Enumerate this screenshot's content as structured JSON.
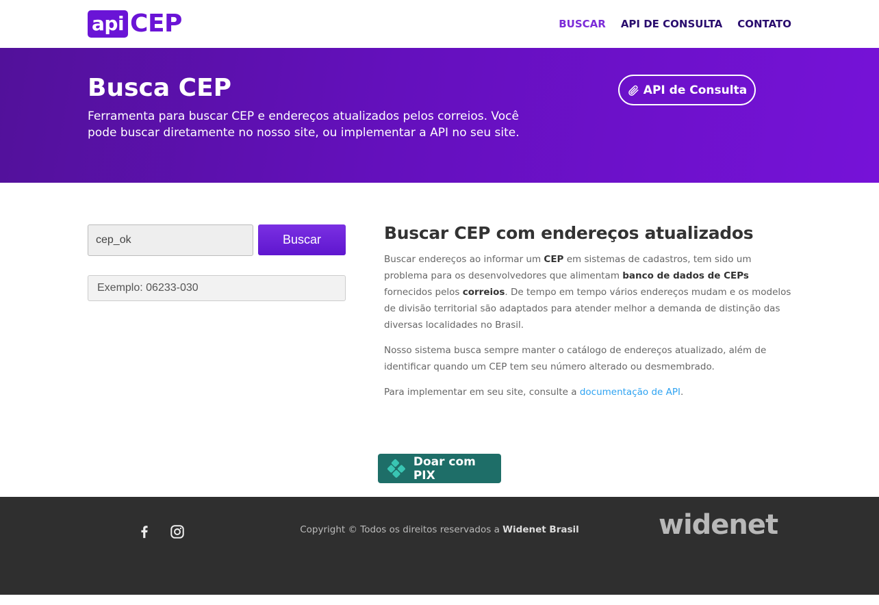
{
  "header": {
    "logo_api": "api",
    "logo_cep": "CEP",
    "nav": [
      {
        "label": "BUSCAR",
        "active": true
      },
      {
        "label": "API DE CONSULTA",
        "active": false
      },
      {
        "label": "CONTATO",
        "active": false
      }
    ]
  },
  "hero": {
    "title": "Busca CEP",
    "description": "Ferramenta para buscar CEP e endereços atualizados pelos correios. Você pode buscar diretamente no nosso site, ou implementar a API no seu site.",
    "button_label": "API de Consulta",
    "button_icon": "paperclip-icon"
  },
  "search": {
    "cep_value": "cep_ok",
    "button_label": "Buscar",
    "example_placeholder": "Exemplo: 06233-030"
  },
  "content": {
    "title": "Buscar CEP com endereços atualizados",
    "p1_a": "Buscar endereços ao informar um ",
    "p1_b1": "CEP",
    "p1_c": " em sistemas de cadastros, tem sido um problema para os desenvolvedores que alimentam ",
    "p1_b2": "banco de dados de CEPs",
    "p1_d": " fornecidos pelos ",
    "p1_b3": "correios",
    "p1_e": ". De tempo em tempo vários endereços mudam e os modelos de divisão territorial são adaptados para atender melhor a demanda de distinção das diversas localidades no Brasil.",
    "p2": "Nosso sistema busca sempre manter o catálogo de endereços atualizado, além de identificar quando um CEP tem seu número alterado ou desmembrado.",
    "p3_a": "Para implementar em seu site, consulte a ",
    "p3_link": "documentação de API",
    "p3_b": "."
  },
  "pix": {
    "label": "Doar com PIX",
    "icon": "pix-icon"
  },
  "footer": {
    "copyright_a": "Copyright © Todos os direitos reservados a ",
    "copyright_b": "Widenet Brasil",
    "logo": "widenet",
    "social": [
      "facebook-icon",
      "instagram-icon"
    ]
  },
  "colors": {
    "brand_purple": "#6a14d6",
    "hero_gradient_start": "#52119a",
    "hero_gradient_end": "#7612d8",
    "link_blue": "#2ea3f2",
    "pix_green": "#1e6e68",
    "footer_bg": "#2f2f2f"
  }
}
